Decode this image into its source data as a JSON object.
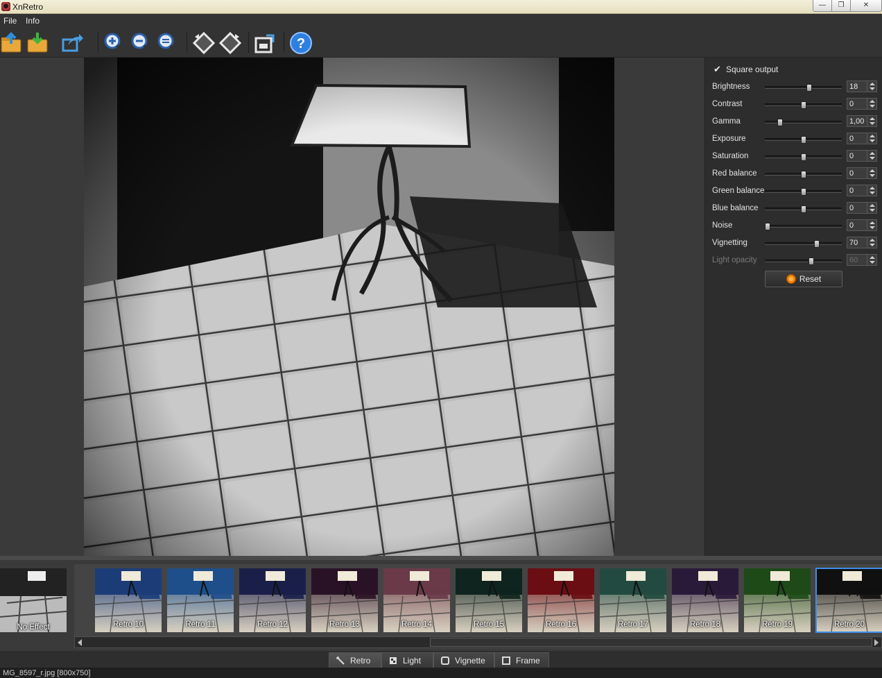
{
  "window": {
    "title": "XnRetro",
    "minimize": "—",
    "maximize": "❐",
    "close": "✕"
  },
  "menu": {
    "items": [
      "File",
      "Info"
    ]
  },
  "toolbar": {
    "buttons": [
      "open-icon",
      "save-icon",
      "share-icon",
      "zoom-in-icon",
      "zoom-out-icon",
      "zoom-fit-icon",
      "rotate-left-icon",
      "rotate-right-icon",
      "crop-icon",
      "help-icon"
    ]
  },
  "panel": {
    "square_output": {
      "label": "Square output",
      "checked": true
    },
    "sliders": [
      {
        "label": "Brightness",
        "value": "18",
        "level": 0.58,
        "enabled": true
      },
      {
        "label": "Contrast",
        "value": "0",
        "level": 0.5,
        "enabled": true
      },
      {
        "label": "Gamma",
        "value": "1,00",
        "level": 0.2,
        "enabled": true
      },
      {
        "label": "Exposure",
        "value": "0",
        "level": 0.5,
        "enabled": true
      },
      {
        "label": "Saturation",
        "value": "0",
        "level": 0.5,
        "enabled": true
      },
      {
        "label": "Red balance",
        "value": "0",
        "level": 0.5,
        "enabled": true
      },
      {
        "label": "Green balance",
        "value": "0",
        "level": 0.5,
        "enabled": true
      },
      {
        "label": "Blue balance",
        "value": "0",
        "level": 0.5,
        "enabled": true
      },
      {
        "label": "Noise",
        "value": "0",
        "level": 0.04,
        "enabled": true
      },
      {
        "label": "Vignetting",
        "value": "70",
        "level": 0.68,
        "enabled": true
      },
      {
        "label": "Light opacity",
        "value": "60",
        "level": 0.6,
        "enabled": false
      }
    ],
    "reset_label": "Reset"
  },
  "thumbnails": {
    "no_effect": "No Effect",
    "items": [
      {
        "label": "Retro 10",
        "color": "#1c3c78"
      },
      {
        "label": "Retro 11",
        "color": "#1f4f8a"
      },
      {
        "label": "Retro 12",
        "color": "#1a1f4a"
      },
      {
        "label": "Retro 13",
        "color": "#2a1226"
      },
      {
        "label": "Retro 14",
        "color": "#6a3a48"
      },
      {
        "label": "Retro 15",
        "color": "#0f241e"
      },
      {
        "label": "Retro 16",
        "color": "#6a0e14"
      },
      {
        "label": "Retro 17",
        "color": "#224a40"
      },
      {
        "label": "Retro 18",
        "color": "#2a1a3a"
      },
      {
        "label": "Retro 19",
        "color": "#1e4a18"
      },
      {
        "label": "Retro 20",
        "color": "#101010",
        "selected": true
      }
    ]
  },
  "tabs": [
    {
      "label": "Retro",
      "icon": "wand-icon",
      "active": true
    },
    {
      "label": "Light",
      "icon": "light-icon",
      "active": false
    },
    {
      "label": "Vignette",
      "icon": "vignette-icon",
      "active": false
    },
    {
      "label": "Frame",
      "icon": "frame-icon",
      "active": false
    }
  ],
  "status": {
    "text": "MG_8597_r.jpg [800x750]"
  }
}
